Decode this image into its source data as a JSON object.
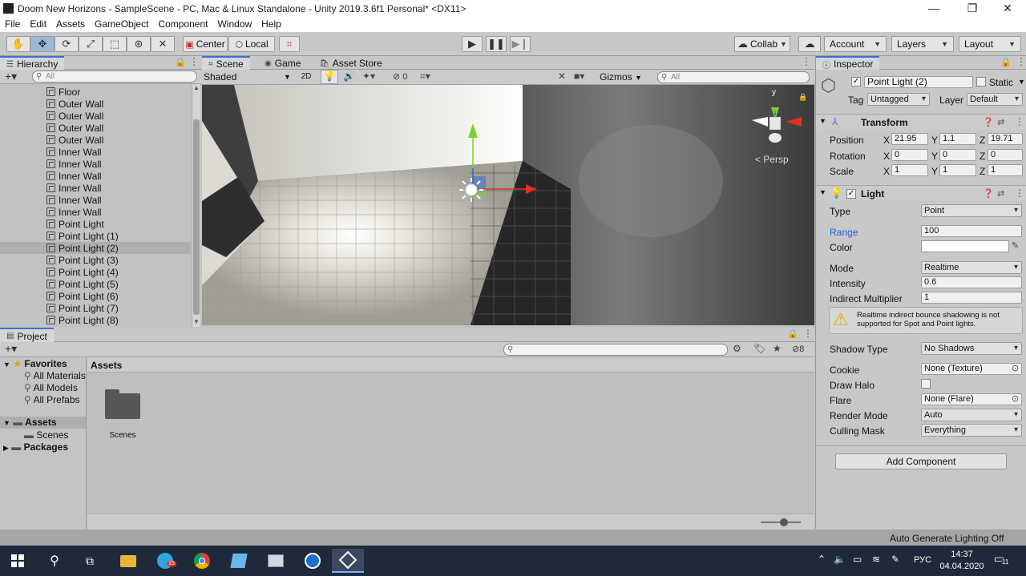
{
  "window": {
    "title": "Doom New Horizons - SampleScene - PC, Mac & Linux Standalone - Unity 2019.3.6f1 Personal* <DX11>",
    "minimize": "—",
    "maximize": "❐",
    "close": "✕"
  },
  "menu": [
    "File",
    "Edit",
    "Assets",
    "GameObject",
    "Component",
    "Window",
    "Help"
  ],
  "toolbar": {
    "center_label": "Center",
    "local_label": "Local",
    "collab_label": "Collab",
    "account_label": "Account",
    "layers_label": "Layers",
    "layout_label": "Layout"
  },
  "hierarchy": {
    "tab": "Hierarchy",
    "search_placeholder": "All",
    "items": [
      "Floor",
      "Outer Wall",
      "Outer Wall",
      "Outer Wall",
      "Outer Wall",
      "Inner Wall",
      "Inner Wall",
      "Inner Wall",
      "Inner Wall",
      "Inner Wall",
      "Inner Wall",
      "Point Light",
      "Point Light (1)",
      "Point Light (2)",
      "Point Light (3)",
      "Point Light (4)",
      "Point Light (5)",
      "Point Light (6)",
      "Point Light (7)",
      "Point Light (8)"
    ],
    "selected_index": 13
  },
  "scene": {
    "tabs": [
      "Scene",
      "Game",
      "Asset Store"
    ],
    "shading": "Shaded",
    "mode_2d": "2D",
    "hidden_count": "0",
    "gizmos": "Gizmos",
    "search_placeholder": "All",
    "persp_label": "Persp",
    "axis_y": "y"
  },
  "inspector": {
    "tab": "Inspector",
    "object_name": "Point Light (2)",
    "static_label": "Static",
    "tag_label": "Tag",
    "tag_value": "Untagged",
    "layer_label": "Layer",
    "layer_value": "Default",
    "transform": {
      "title": "Transform",
      "position_label": "Position",
      "rotation_label": "Rotation",
      "scale_label": "Scale",
      "position": {
        "x": "21.95",
        "y": "1.1",
        "z": "19.71"
      },
      "rotation": {
        "x": "0",
        "y": "0",
        "z": "0"
      },
      "scale": {
        "x": "1",
        "y": "1",
        "z": "1"
      },
      "x_label": "X",
      "y_label": "Y",
      "z_label": "Z"
    },
    "light": {
      "title": "Light",
      "type_label": "Type",
      "type_value": "Point",
      "range_label": "Range",
      "range_value": "100",
      "color_label": "Color",
      "mode_label": "Mode",
      "mode_value": "Realtime",
      "intensity_label": "Intensity",
      "intensity_value": "0.6",
      "indirect_label": "Indirect Multiplier",
      "indirect_value": "1",
      "warning": "Realtime indirect bounce shadowing is not supported for Spot and Point lights.",
      "shadow_label": "Shadow Type",
      "shadow_value": "No Shadows",
      "cookie_label": "Cookie",
      "cookie_value": "None (Texture)",
      "halo_label": "Draw Halo",
      "flare_label": "Flare",
      "flare_value": "None (Flare)",
      "render_label": "Render Mode",
      "render_value": "Auto",
      "culling_label": "Culling Mask",
      "culling_value": "Everything"
    },
    "add_component": "Add Component"
  },
  "project": {
    "tab": "Project",
    "favorites_label": "Favorites",
    "favorites": [
      "All Materials",
      "All Models",
      "All Prefabs"
    ],
    "assets_label": "Assets",
    "scenes_label": "Scenes",
    "packages_label": "Packages",
    "breadcrumb": "Assets",
    "folder_name": "Scenes",
    "hidden_count": "8"
  },
  "status": {
    "lighting": "Auto Generate Lighting Off"
  },
  "taskbar": {
    "lang": "РУС",
    "time": "14:37",
    "date": "04.04.2020",
    "badge": "15",
    "notif": "11"
  },
  "colors": {
    "accent": "#3a72d1",
    "link_blue": "#2a5bd7"
  }
}
